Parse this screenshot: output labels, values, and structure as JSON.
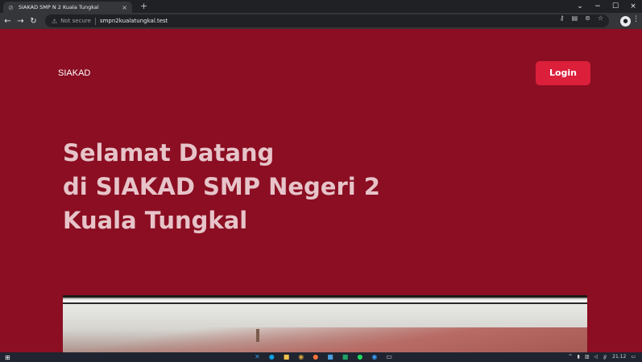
{
  "browser": {
    "tab_title": "SIAKAD SMP N 2 Kuala Tungkal",
    "tab_close": "×",
    "new_tab": "+",
    "not_secure": "Not secure",
    "url": "smpn2kualatungkal.test",
    "window_minimize": "−",
    "window_maximize": "☐",
    "window_close": "×"
  },
  "page": {
    "brand": "SIAKAD",
    "login_label": "Login",
    "hero_line1": "Selamat Datang",
    "hero_line2": "di SIAKAD SMP Negeri 2",
    "hero_line3": "Kuala Tungkal"
  },
  "taskbar": {
    "clock": "21.12"
  },
  "colors": {
    "page_bg": "#8b0e22",
    "login_bg": "#dc1f3b",
    "hero_text": "#e6c4c9"
  }
}
